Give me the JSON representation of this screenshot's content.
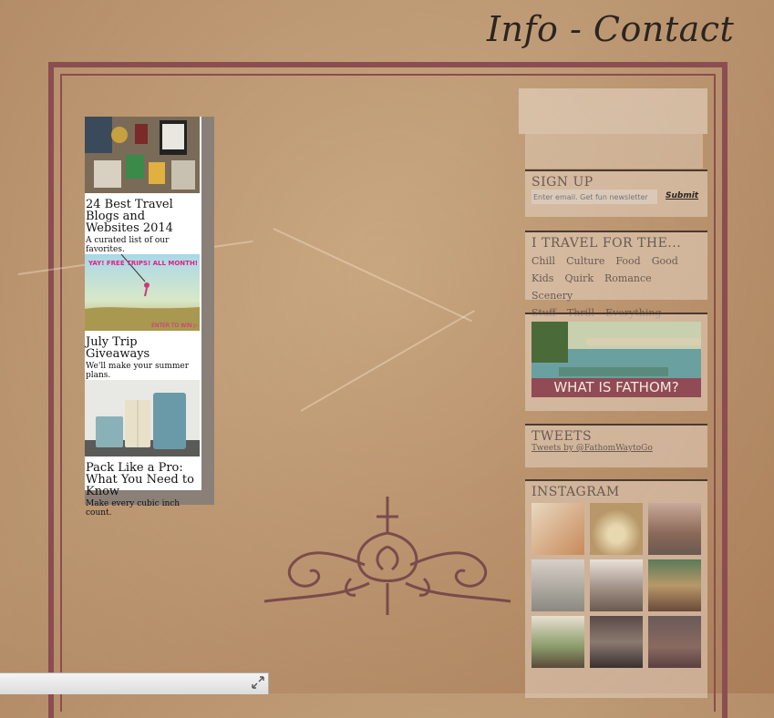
{
  "page": {
    "title": "Info - Contact"
  },
  "promo": {
    "items": [
      {
        "title": "24 Best Travel Blogs and Websites 2014",
        "desc": "A curated list of our favorites."
      },
      {
        "title": "July Trip Giveaways",
        "desc": "We'll make your summer plans."
      },
      {
        "title": "Pack Like a Pro: What You Need to Know",
        "desc": "Make every cubic inch count."
      }
    ],
    "giveaway_banner": "YAY! FREE TRIPS! ALL MONTH!",
    "giveaway_cta": "ENTER TO WIN ▷"
  },
  "sidebar": {
    "signup": {
      "heading": "SIGN UP",
      "placeholder": "Enter email. Get fun newsletter",
      "submit": "Submit"
    },
    "travel": {
      "heading": "I TRAVEL FOR THE...",
      "tags": [
        "Chill",
        "Culture",
        "Food",
        "Good",
        "Kids",
        "Quirk",
        "Romance",
        "Scenery",
        "Stuff",
        "Thrill",
        "Everything"
      ]
    },
    "about": {
      "label": "WHAT IS FATHOM?"
    },
    "tweets": {
      "heading": "TWEETS",
      "link": "Tweets by @FathomWaytoGo"
    },
    "instagram": {
      "heading": "INSTAGRAM"
    }
  },
  "colors": {
    "frame": "#8b4d52",
    "paper": "#c9a57e",
    "ink": "#2b2420"
  },
  "icons": {
    "expand": "expand-icon",
    "ornament": "flourish-ornament"
  }
}
